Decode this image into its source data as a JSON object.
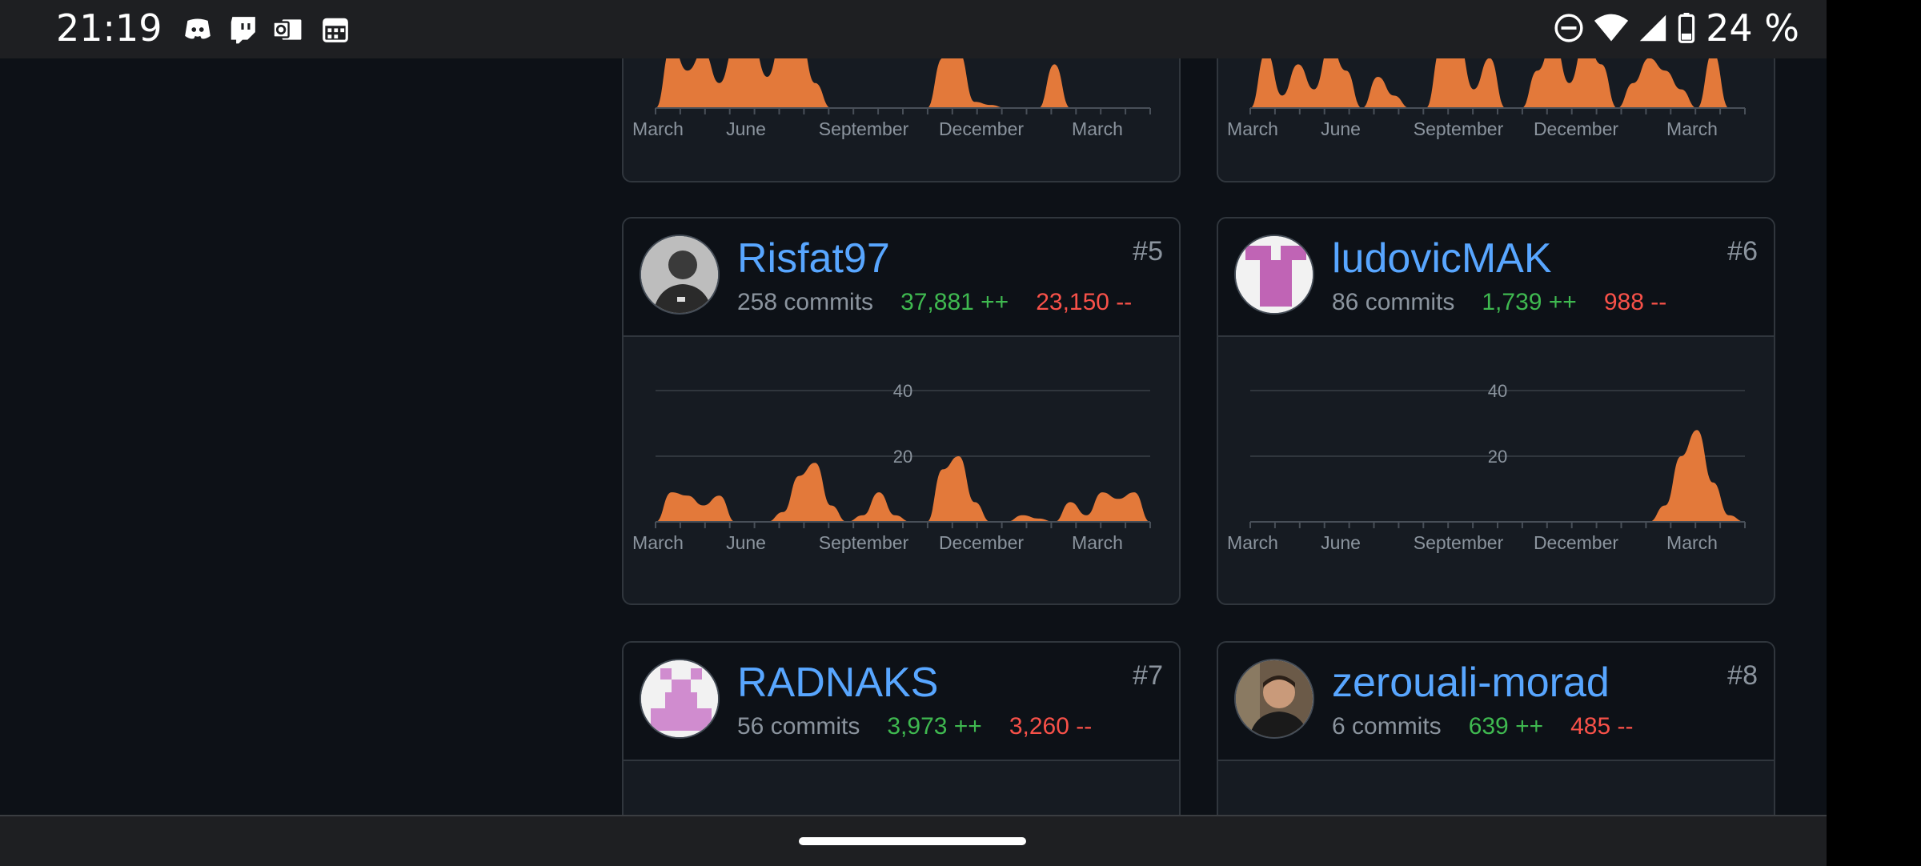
{
  "status_bar": {
    "time": "21:19",
    "battery": "24 %",
    "notification_icons": [
      "discord-icon",
      "twitch-icon",
      "outlook-icon",
      "calendar-icon"
    ],
    "system_icons": [
      "do-not-disturb-icon",
      "wifi-icon",
      "signal-icon",
      "battery-icon"
    ]
  },
  "months": [
    "March",
    "June",
    "September",
    "December",
    "March"
  ],
  "colors": {
    "area": "#e3793a",
    "username": "#58a6ff",
    "additions": "#3fb950",
    "deletions": "#f85149"
  },
  "cards": [
    {
      "username": "Risfat97",
      "commits": "258 commits",
      "additions": "37,881 ++",
      "deletions": "23,150 --",
      "rank": "#5"
    },
    {
      "username": "ludovicMAK",
      "commits": "86 commits",
      "additions": "1,739 ++",
      "deletions": "988 --",
      "rank": "#6"
    },
    {
      "username": "RADNAKS",
      "commits": "56 commits",
      "additions": "3,973 ++",
      "deletions": "3,260 --",
      "rank": "#7"
    },
    {
      "username": "zerouali-morad",
      "commits": "6 commits",
      "additions": "639 ++",
      "deletions": "485 --",
      "rank": "#8"
    }
  ],
  "chart_data": [
    {
      "type": "area",
      "x": [
        "March",
        "June",
        "September",
        "December",
        "March"
      ],
      "y_ticks": [
        20,
        40
      ],
      "ylim": [
        0,
        45
      ],
      "series": [
        {
          "values": [
            0,
            9,
            8,
            5,
            8,
            0,
            0,
            0,
            3,
            14,
            18,
            5,
            0,
            2,
            9,
            2,
            0,
            0,
            16,
            20,
            6,
            0,
            0,
            2,
            1,
            0,
            6,
            2,
            9,
            7,
            9,
            0
          ]
        }
      ]
    },
    {
      "type": "area",
      "x": [
        "March",
        "June",
        "September",
        "December",
        "March"
      ],
      "y_ticks": [
        20,
        40
      ],
      "ylim": [
        0,
        45
      ],
      "series": [
        {
          "values": [
            0,
            0,
            0,
            0,
            0,
            0,
            0,
            0,
            0,
            0,
            0,
            0,
            0,
            0,
            0,
            0,
            0,
            0,
            0,
            0,
            0,
            0,
            0,
            0,
            0,
            0,
            5,
            20,
            28,
            12,
            2,
            0
          ]
        }
      ]
    },
    {
      "type": "area",
      "x": [
        "March",
        "June",
        "September",
        "December",
        "March"
      ],
      "series": [
        {
          "values": [
            0,
            20,
            12,
            18,
            8,
            20,
            22,
            10,
            24,
            24,
            8,
            0,
            0,
            0,
            0,
            0,
            0,
            0,
            16,
            18,
            2,
            1,
            0,
            0,
            0,
            14,
            0,
            0,
            0,
            0,
            0,
            0
          ]
        }
      ]
    },
    {
      "type": "area",
      "x": [
        "March",
        "June",
        "September",
        "December",
        "March"
      ],
      "series": [
        {
          "values": [
            0,
            18,
            4,
            14,
            6,
            20,
            12,
            0,
            10,
            4,
            0,
            0,
            20,
            22,
            6,
            16,
            0,
            0,
            12,
            22,
            8,
            22,
            14,
            0,
            8,
            16,
            12,
            6,
            0,
            18,
            0,
            0
          ]
        }
      ]
    }
  ]
}
